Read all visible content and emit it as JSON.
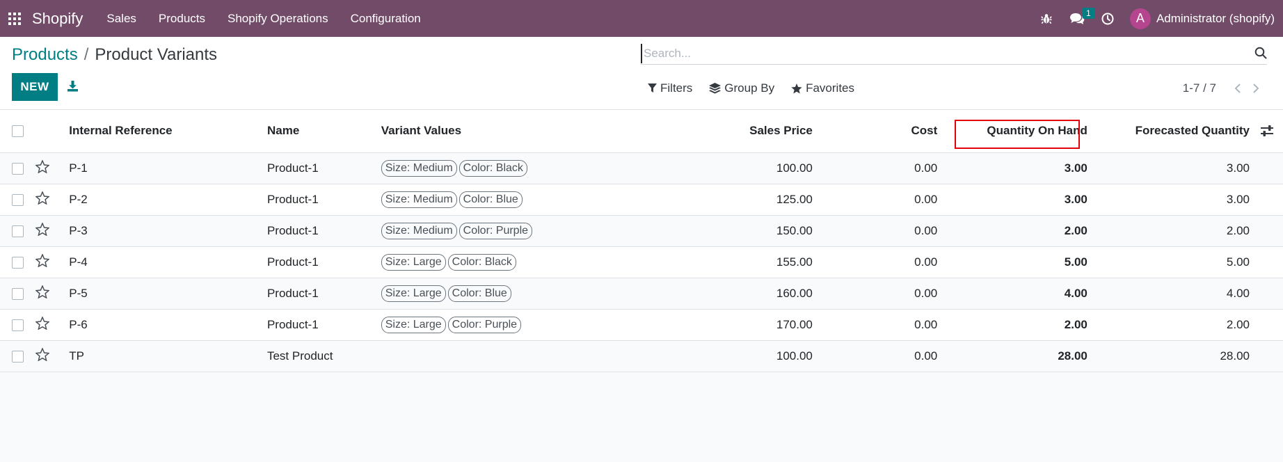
{
  "navbar": {
    "brand": "Shopify",
    "menu": [
      "Sales",
      "Products",
      "Shopify Operations",
      "Configuration"
    ],
    "messages_badge": "1",
    "user_initial": "A",
    "user_name": "Administrator (shopify)",
    "color": "#714B67"
  },
  "breadcrumb": {
    "parent": "Products",
    "separator": "/",
    "current": "Product Variants"
  },
  "actions": {
    "new_label": "NEW"
  },
  "search": {
    "placeholder": "Search..."
  },
  "filters": {
    "filters_label": "Filters",
    "group_by_label": "Group By",
    "favorites_label": "Favorites"
  },
  "pager": {
    "value": "1-7 / 7"
  },
  "table": {
    "headers": {
      "ref": "Internal Reference",
      "name": "Name",
      "variant": "Variant Values",
      "sales": "Sales Price",
      "cost": "Cost",
      "qty": "Quantity On Hand",
      "forecast": "Forecasted Quantity"
    },
    "rows": [
      {
        "ref": "P-1",
        "name": "Product-1",
        "tags": [
          "Size: Medium",
          "Color: Black"
        ],
        "sales": "100.00",
        "cost": "0.00",
        "qty": "3.00",
        "forecast": "3.00"
      },
      {
        "ref": "P-2",
        "name": "Product-1",
        "tags": [
          "Size: Medium",
          "Color: Blue"
        ],
        "sales": "125.00",
        "cost": "0.00",
        "qty": "3.00",
        "forecast": "3.00"
      },
      {
        "ref": "P-3",
        "name": "Product-1",
        "tags": [
          "Size: Medium",
          "Color: Purple"
        ],
        "sales": "150.00",
        "cost": "0.00",
        "qty": "2.00",
        "forecast": "2.00"
      },
      {
        "ref": "P-4",
        "name": "Product-1",
        "tags": [
          "Size: Large",
          "Color: Black"
        ],
        "sales": "155.00",
        "cost": "0.00",
        "qty": "5.00",
        "forecast": "5.00"
      },
      {
        "ref": "P-5",
        "name": "Product-1",
        "tags": [
          "Size: Large",
          "Color: Blue"
        ],
        "sales": "160.00",
        "cost": "0.00",
        "qty": "4.00",
        "forecast": "4.00"
      },
      {
        "ref": "P-6",
        "name": "Product-1",
        "tags": [
          "Size: Large",
          "Color: Purple"
        ],
        "sales": "170.00",
        "cost": "0.00",
        "qty": "2.00",
        "forecast": "2.00"
      },
      {
        "ref": "TP",
        "name": "Test Product",
        "tags": [],
        "sales": "100.00",
        "cost": "0.00",
        "qty": "28.00",
        "forecast": "28.00"
      }
    ]
  },
  "accent_color": "#017e84",
  "highlight_color": "#e3000b"
}
